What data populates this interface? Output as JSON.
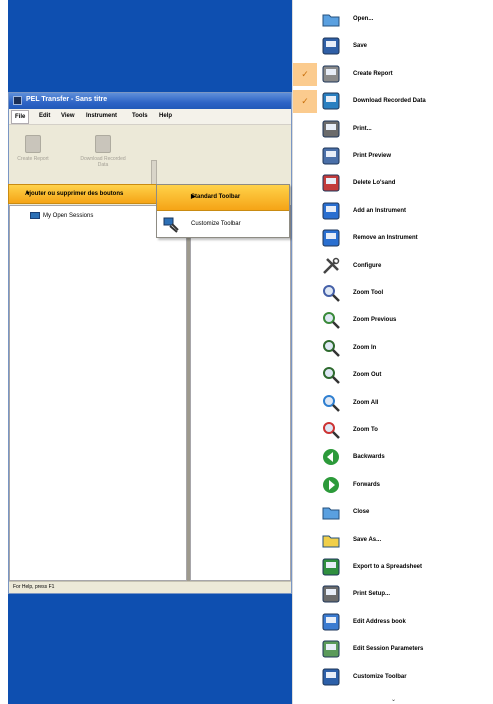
{
  "window": {
    "title": "PEL Transfer - Sans titre",
    "menus": [
      "File",
      "Edit",
      "View",
      "Instrument",
      "Tools",
      "Help"
    ],
    "toolbar": {
      "create_report": "Create Report",
      "download_line1": "Download Recorded",
      "download_line2": "Data"
    },
    "tree": {
      "node_label": "My Open Sessions"
    },
    "status": "For Help, press F1"
  },
  "context_menu": {
    "item_label": "Ajouter ou supprimer des boutons",
    "submenu": {
      "standard_toolbar": "Standard Toolbar",
      "customize_toolbar": "Customize Toolbar"
    }
  },
  "command_menu": {
    "items": [
      {
        "label": "Open...",
        "icon": "open-folder-icon",
        "checked": false
      },
      {
        "label": "Save",
        "icon": "floppy-disk-icon",
        "checked": false
      },
      {
        "label": "Create Report",
        "icon": "report-icon",
        "checked": true
      },
      {
        "label": "Download Recorded Data",
        "icon": "download-data-icon",
        "checked": true
      },
      {
        "label": "Print...",
        "icon": "printer-icon",
        "checked": false
      },
      {
        "label": "Print Preview",
        "icon": "print-preview-icon",
        "checked": false
      },
      {
        "label": "Delete Lo'sand",
        "icon": "delete-icon",
        "checked": false
      },
      {
        "label": "Add an Instrument",
        "icon": "add-instrument-icon",
        "checked": false
      },
      {
        "label": "Remove an Instrument",
        "icon": "remove-instrument-icon",
        "checked": false
      },
      {
        "label": "Configure",
        "icon": "configure-icon",
        "checked": false
      },
      {
        "label": "Zoom Tool",
        "icon": "zoom-tool-icon",
        "checked": false
      },
      {
        "label": "Zoom Previous",
        "icon": "zoom-previous-icon",
        "checked": false
      },
      {
        "label": "Zoom In",
        "icon": "zoom-in-icon",
        "checked": false
      },
      {
        "label": "Zoom Out",
        "icon": "zoom-out-icon",
        "checked": false
      },
      {
        "label": "Zoom All",
        "icon": "zoom-all-icon",
        "checked": false
      },
      {
        "label": "Zoom To",
        "icon": "zoom-to-icon",
        "checked": false
      },
      {
        "label": "Backwards",
        "icon": "backwards-icon",
        "checked": false
      },
      {
        "label": "Forwards",
        "icon": "forwards-icon",
        "checked": false
      },
      {
        "label": "Close",
        "icon": "close-folder-icon",
        "checked": false
      },
      {
        "label": "Save As...",
        "icon": "save-as-icon",
        "checked": false
      },
      {
        "label": "Export to a Spreadsheet",
        "icon": "export-spreadsheet-icon",
        "checked": false
      },
      {
        "label": "Print Setup...",
        "icon": "print-setup-icon",
        "checked": false
      },
      {
        "label": "Edit Address book",
        "icon": "address-book-icon",
        "checked": false
      },
      {
        "label": "Edit Session Parameters",
        "icon": "session-parameters-icon",
        "checked": false
      },
      {
        "label": "Customize Toolbar",
        "icon": "customize-toolbar-icon",
        "checked": false
      }
    ],
    "more_arrow": "⌄"
  },
  "colors": {
    "desktop_blue": "#0e4fb0",
    "highlight_orange": "#f5a416",
    "check_bg": "#fbcb8e"
  }
}
